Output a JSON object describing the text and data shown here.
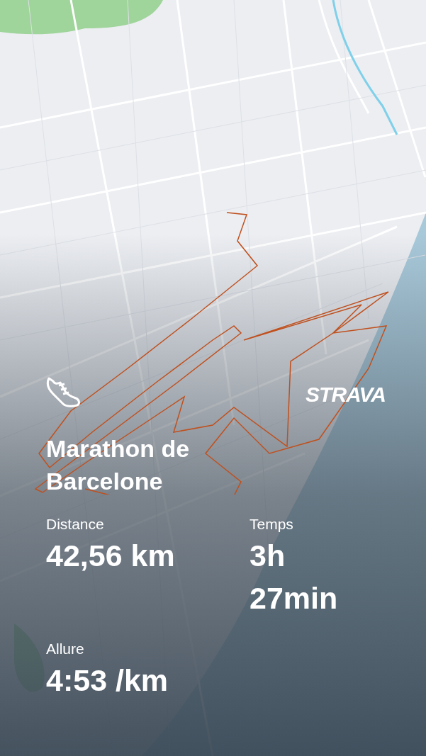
{
  "logo": "STRAVA",
  "activity": {
    "title": "Marathon de Barcelone"
  },
  "stats": [
    {
      "label": "Distance",
      "value": "42,56 km"
    },
    {
      "label": "Temps",
      "value": "3h 27min"
    },
    {
      "label": "Allure",
      "value": "4:53 /km"
    }
  ]
}
